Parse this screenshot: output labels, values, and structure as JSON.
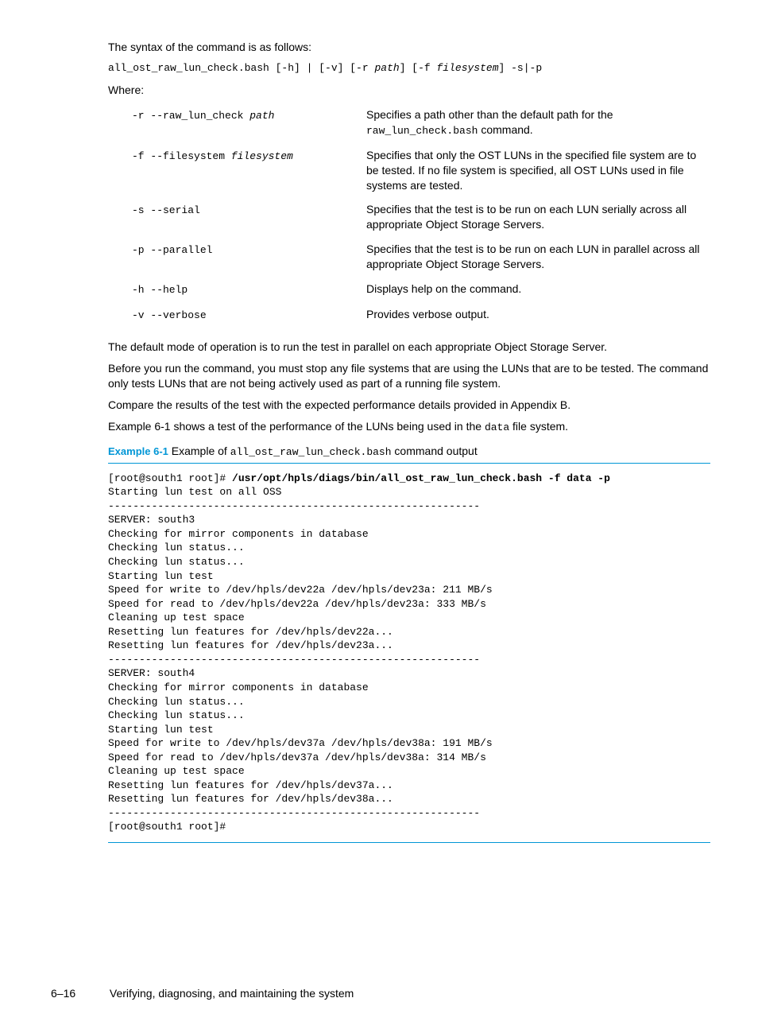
{
  "para_syntax_intro": "The syntax of the command is as follows:",
  "syntax_prefix": "all_ost_raw_lun_check.bash [-h] | [-v] [-r ",
  "syntax_arg1": "path",
  "syntax_mid": "] [-f ",
  "syntax_arg2": "filesystem",
  "syntax_suffix": "] -s|-p",
  "where_label": "Where:",
  "options": [
    {
      "flag": "-r --raw_lun_check ",
      "arg": "path",
      "desc_before": "Specifies a path other than the default path for the ",
      "desc_mono": "raw_lun_check.bash",
      "desc_after": " command."
    },
    {
      "flag": "-f --filesystem ",
      "arg": "filesystem",
      "desc": "Specifies that only the OST LUNs in the specified file system are to be tested. If no file system is specified, all OST LUNs used in file systems are tested."
    },
    {
      "flag": "-s --serial",
      "arg": "",
      "desc": "Specifies that the test is to be run on each LUN serially across all appropriate Object Storage Servers."
    },
    {
      "flag": "-p --parallel",
      "arg": "",
      "desc": "Specifies that the test is to be run on each LUN in parallel across all appropriate Object Storage Servers."
    },
    {
      "flag": "-h --help",
      "arg": "",
      "desc": "Displays help on the command."
    },
    {
      "flag": "-v --verbose",
      "arg": "",
      "desc": "Provides verbose output."
    }
  ],
  "para_default": "The default mode of operation is to run the test in parallel on each appropriate Object Storage Server.",
  "para_before": "Before you run the command, you must stop any file systems that are using the LUNs that are to be tested. The command only tests LUNs that are not being actively used as part of a running file system.",
  "para_compare": "Compare the results of the test with the expected performance details provided in Appendix B.",
  "para_example_pre": "Example 6-1 shows a test of the performance of the  LUNs being used in the ",
  "para_example_mono": "data",
  "para_example_post": " file system.",
  "caption_label": "Example 6-1",
  "caption_text_pre": " Example of ",
  "caption_mono": "all_ost_raw_lun_check.bash",
  "caption_text_post": " command output",
  "code_prompt": "[root@south1 root]# ",
  "code_cmd": "/usr/opt/hpls/diags/bin/all_ost_raw_lun_check.bash -f data -p",
  "code_body": "Starting lun test on all OSS\n------------------------------------------------------------\nSERVER: south3\nChecking for mirror components in database\nChecking lun status...\nChecking lun status...\nStarting lun test\nSpeed for write to /dev/hpls/dev22a /dev/hpls/dev23a: 211 MB/s\nSpeed for read to /dev/hpls/dev22a /dev/hpls/dev23a: 333 MB/s\nCleaning up test space\nResetting lun features for /dev/hpls/dev22a...\nResetting lun features for /dev/hpls/dev23a...\n------------------------------------------------------------\nSERVER: south4\nChecking for mirror components in database\nChecking lun status...\nChecking lun status...\nStarting lun test\nSpeed for write to /dev/hpls/dev37a /dev/hpls/dev38a: 191 MB/s\nSpeed for read to /dev/hpls/dev37a /dev/hpls/dev38a: 314 MB/s\nCleaning up test space\nResetting lun features for /dev/hpls/dev37a...\nResetting lun features for /dev/hpls/dev38a...\n------------------------------------------------------------\n[root@south1 root]#",
  "footer_page": "6–16",
  "footer_title": "Verifying, diagnosing, and maintaining the system"
}
